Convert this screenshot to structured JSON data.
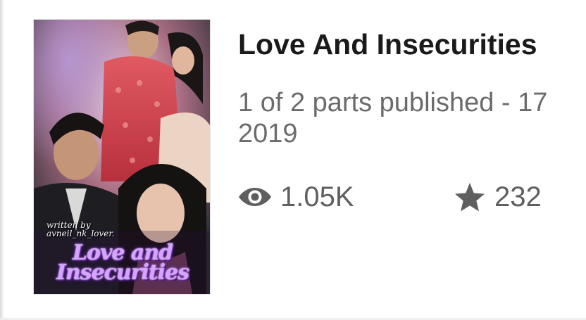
{
  "story": {
    "title": "Love And Insecurities",
    "parts_line1": "1 of 2 parts published - 17",
    "parts_line2": "2019",
    "views": "1.05K",
    "votes": "232",
    "cover": {
      "written_by": "written by",
      "author_handle": "avneil_nk_lover.",
      "title_line1": "Love and",
      "title_line2": "Insecurities"
    }
  },
  "icons": {
    "views": "eye-icon",
    "votes": "star-icon"
  },
  "colors": {
    "title": "#1a1a1a",
    "meta": "#6b6b6b",
    "stat": "#5f5f5f",
    "cover_title": "#d6a4ff"
  }
}
